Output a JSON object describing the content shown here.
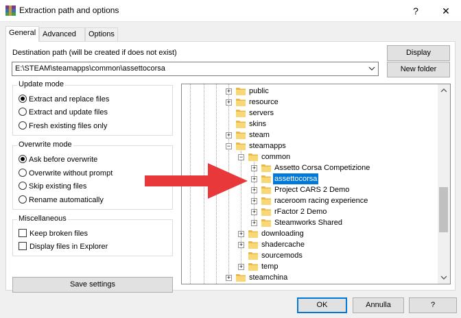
{
  "window": {
    "title": "Extraction path and options",
    "help_button": "?",
    "close_button": "✕"
  },
  "tabs": [
    {
      "label": "General",
      "active": true
    },
    {
      "label": "Advanced",
      "active": false
    },
    {
      "label": "Options",
      "active": false
    }
  ],
  "destination": {
    "label": "Destination path (will be created if does not exist)",
    "value": "E:\\STEAM\\steamapps\\common\\assettocorsa"
  },
  "buttons": {
    "display": "Display",
    "new_folder": "New folder",
    "save_settings": "Save settings",
    "ok": "OK",
    "cancel": "Annulla",
    "help": "?"
  },
  "update_mode": {
    "title": "Update mode",
    "options": [
      {
        "label": "Extract and replace files",
        "selected": true
      },
      {
        "label": "Extract and update files",
        "selected": false
      },
      {
        "label": "Fresh existing files only",
        "selected": false
      }
    ]
  },
  "overwrite_mode": {
    "title": "Overwrite mode",
    "options": [
      {
        "label": "Ask before overwrite",
        "selected": true
      },
      {
        "label": "Overwrite without prompt",
        "selected": false
      },
      {
        "label": "Skip existing files",
        "selected": false
      },
      {
        "label": "Rename automatically",
        "selected": false
      }
    ]
  },
  "misc": {
    "title": "Miscellaneous",
    "options": [
      {
        "label": "Keep broken files",
        "checked": false
      },
      {
        "label": "Display files in Explorer",
        "checked": false
      }
    ]
  },
  "tree": {
    "items": [
      {
        "label": "public",
        "expander": "+"
      },
      {
        "label": "resource",
        "expander": "+"
      },
      {
        "label": "servers",
        "expander": ""
      },
      {
        "label": "skins",
        "expander": ""
      },
      {
        "label": "steam",
        "expander": "+"
      },
      {
        "label": "steamapps",
        "expander": "−"
      },
      {
        "label": "common",
        "expander": "−"
      },
      {
        "label": "Assetto Corsa Competizione",
        "expander": "+"
      },
      {
        "label": "assettocorsa",
        "expander": "+",
        "selected": true
      },
      {
        "label": "Project CARS 2 Demo",
        "expander": "+"
      },
      {
        "label": "raceroom racing experience",
        "expander": "+"
      },
      {
        "label": "rFactor 2 Demo",
        "expander": "+"
      },
      {
        "label": "Steamworks Shared",
        "expander": "+"
      },
      {
        "label": "downloading",
        "expander": "+"
      },
      {
        "label": "shadercache",
        "expander": "+"
      },
      {
        "label": "sourcemods",
        "expander": ""
      },
      {
        "label": "temp",
        "expander": "+"
      },
      {
        "label": "steamchina",
        "expander": "+"
      }
    ]
  },
  "colors": {
    "accent": "#0078d7",
    "folder": "#f8d775",
    "arrow": "#e8383a"
  },
  "icons": {
    "app": "winrar-icon",
    "folder": "folder-icon",
    "annotation": "red-arrow"
  }
}
